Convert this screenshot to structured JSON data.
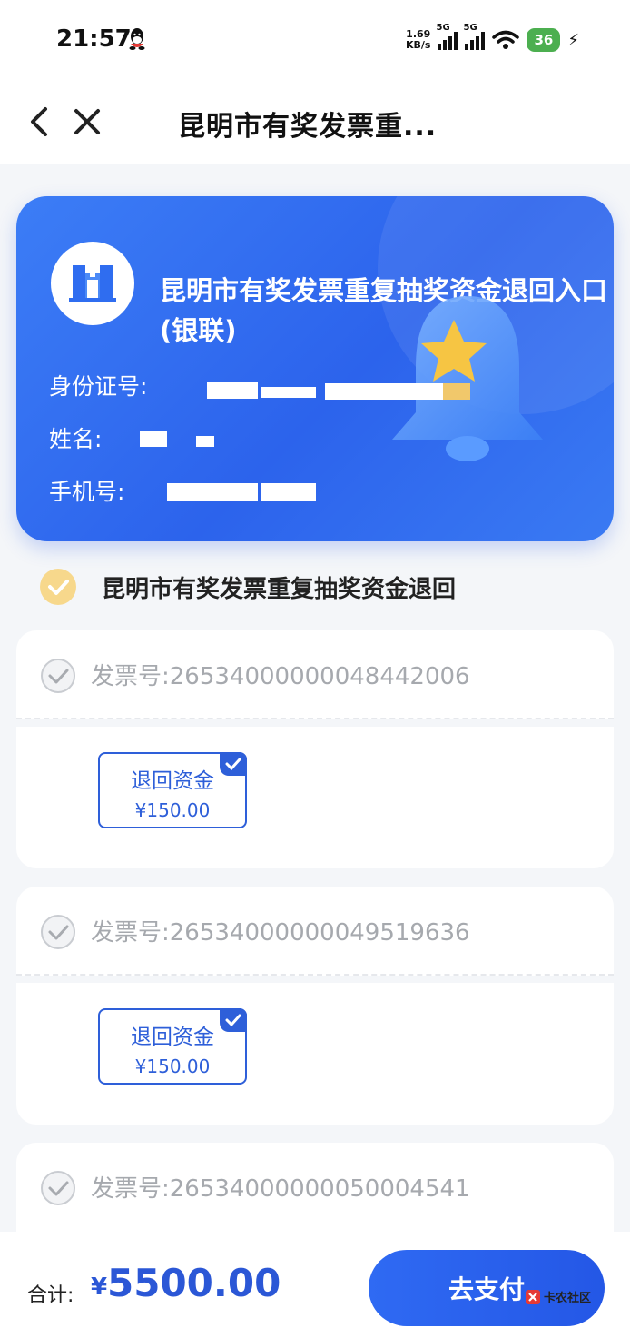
{
  "status_bar": {
    "time": "21:57",
    "net_speed_value": "1.69",
    "net_speed_unit": "KB/s",
    "sim1_label": "5G",
    "sim2_label": "5G",
    "battery": "36"
  },
  "nav": {
    "title": "昆明市有奖发票重..."
  },
  "card": {
    "title": "昆明市有奖发票重复抽奖资金退回入口(银联)",
    "id_label": "身份证号:",
    "name_label": "姓名:",
    "phone_label": "手机号:",
    "brand_color": "#2c63ec"
  },
  "section": {
    "title": "昆明市有奖发票重复抽奖资金退回"
  },
  "invoices": [
    {
      "number": "发票号:26534000000048442006",
      "refund_label": "退回资金",
      "refund_amount": "¥150.00"
    },
    {
      "number": "发票号:26534000000049519636",
      "refund_label": "退回资金",
      "refund_amount": "¥150.00"
    },
    {
      "number": "发票号:26534000000050004541"
    }
  ],
  "footer": {
    "total_label": "合计:",
    "currency": "¥",
    "total_amount": "5500.00",
    "pay_button": "去支付"
  },
  "watermark": "卡农社区"
}
